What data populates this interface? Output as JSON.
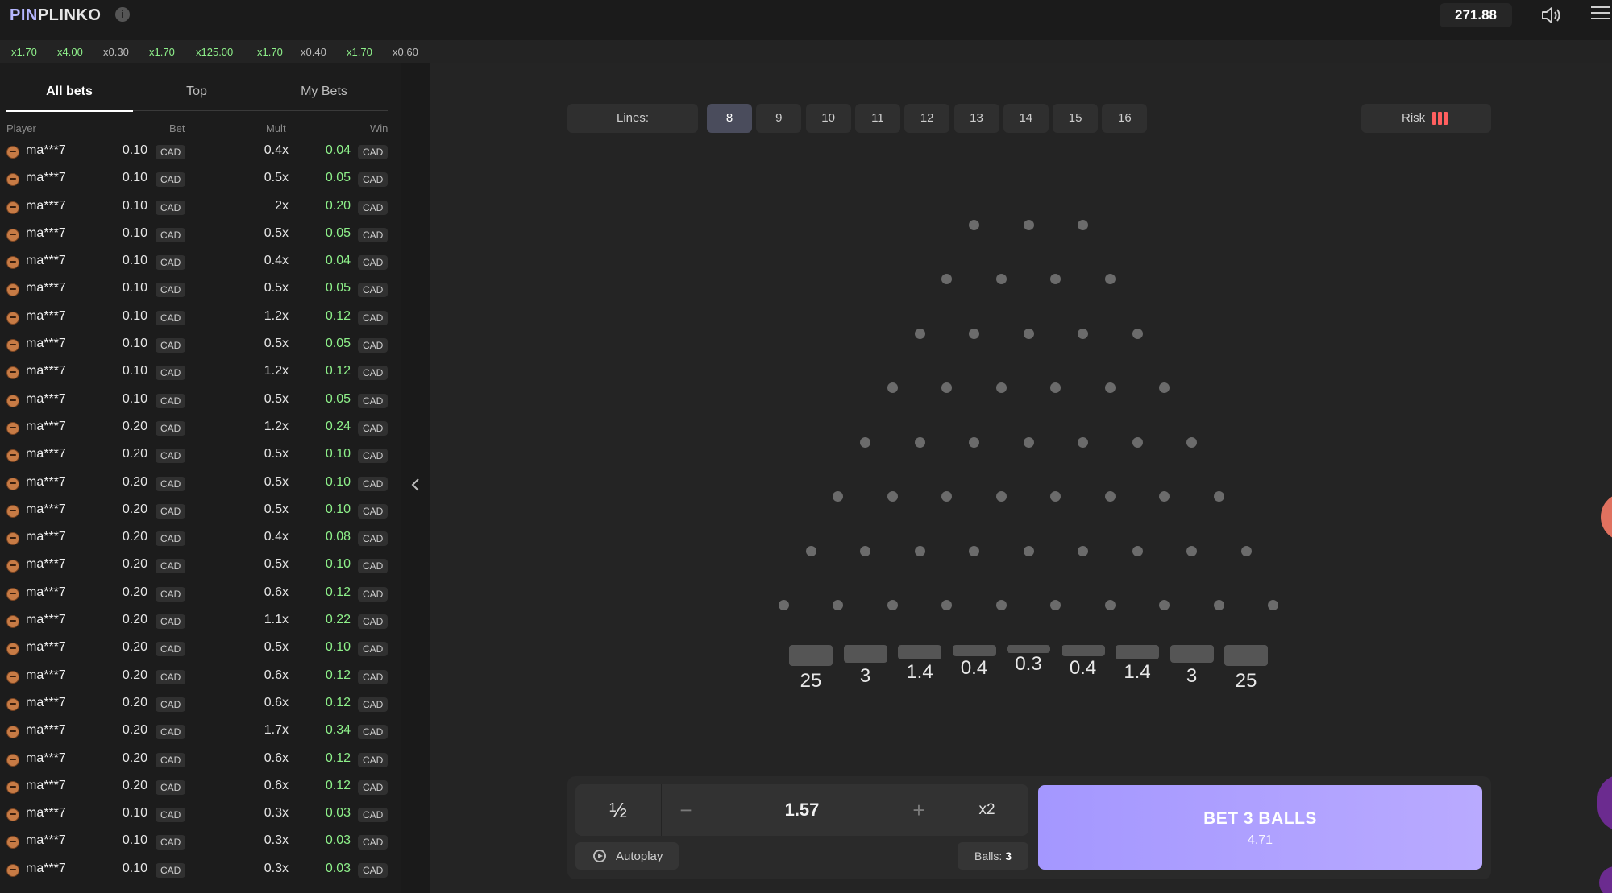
{
  "header": {
    "logo_part1": "PIN",
    "logo_part2": "PLINKO",
    "info_label": "i",
    "balance": "271.88"
  },
  "history": [
    "x1.70",
    "x4.00",
    "x0.30",
    "x1.70",
    "x125.00",
    "x1.70",
    "x0.40",
    "x1.70",
    "x0.60"
  ],
  "sidebar": {
    "tabs": [
      "All bets",
      "Top",
      "My Bets"
    ],
    "columns": {
      "player": "Player",
      "bet": "Bet",
      "mult": "Mult",
      "win": "Win"
    },
    "rows": [
      {
        "player": "ma***7",
        "bet": "0.10",
        "currency": "CAD",
        "mult": "0.4x",
        "win": "0.04"
      },
      {
        "player": "ma***7",
        "bet": "0.10",
        "currency": "CAD",
        "mult": "0.5x",
        "win": "0.05"
      },
      {
        "player": "ma***7",
        "bet": "0.10",
        "currency": "CAD",
        "mult": "2x",
        "win": "0.20"
      },
      {
        "player": "ma***7",
        "bet": "0.10",
        "currency": "CAD",
        "mult": "0.5x",
        "win": "0.05"
      },
      {
        "player": "ma***7",
        "bet": "0.10",
        "currency": "CAD",
        "mult": "0.4x",
        "win": "0.04"
      },
      {
        "player": "ma***7",
        "bet": "0.10",
        "currency": "CAD",
        "mult": "0.5x",
        "win": "0.05"
      },
      {
        "player": "ma***7",
        "bet": "0.10",
        "currency": "CAD",
        "mult": "1.2x",
        "win": "0.12"
      },
      {
        "player": "ma***7",
        "bet": "0.10",
        "currency": "CAD",
        "mult": "0.5x",
        "win": "0.05"
      },
      {
        "player": "ma***7",
        "bet": "0.10",
        "currency": "CAD",
        "mult": "1.2x",
        "win": "0.12"
      },
      {
        "player": "ma***7",
        "bet": "0.10",
        "currency": "CAD",
        "mult": "0.5x",
        "win": "0.05"
      },
      {
        "player": "ma***7",
        "bet": "0.20",
        "currency": "CAD",
        "mult": "1.2x",
        "win": "0.24"
      },
      {
        "player": "ma***7",
        "bet": "0.20",
        "currency": "CAD",
        "mult": "0.5x",
        "win": "0.10"
      },
      {
        "player": "ma***7",
        "bet": "0.20",
        "currency": "CAD",
        "mult": "0.5x",
        "win": "0.10"
      },
      {
        "player": "ma***7",
        "bet": "0.20",
        "currency": "CAD",
        "mult": "0.5x",
        "win": "0.10"
      },
      {
        "player": "ma***7",
        "bet": "0.20",
        "currency": "CAD",
        "mult": "0.4x",
        "win": "0.08"
      },
      {
        "player": "ma***7",
        "bet": "0.20",
        "currency": "CAD",
        "mult": "0.5x",
        "win": "0.10"
      },
      {
        "player": "ma***7",
        "bet": "0.20",
        "currency": "CAD",
        "mult": "0.6x",
        "win": "0.12"
      },
      {
        "player": "ma***7",
        "bet": "0.20",
        "currency": "CAD",
        "mult": "1.1x",
        "win": "0.22"
      },
      {
        "player": "ma***7",
        "bet": "0.20",
        "currency": "CAD",
        "mult": "0.5x",
        "win": "0.10"
      },
      {
        "player": "ma***7",
        "bet": "0.20",
        "currency": "CAD",
        "mult": "0.6x",
        "win": "0.12"
      },
      {
        "player": "ma***7",
        "bet": "0.20",
        "currency": "CAD",
        "mult": "0.6x",
        "win": "0.12"
      },
      {
        "player": "ma***7",
        "bet": "0.20",
        "currency": "CAD",
        "mult": "1.7x",
        "win": "0.34"
      },
      {
        "player": "ma***7",
        "bet": "0.20",
        "currency": "CAD",
        "mult": "0.6x",
        "win": "0.12"
      },
      {
        "player": "ma***7",
        "bet": "0.20",
        "currency": "CAD",
        "mult": "0.6x",
        "win": "0.12"
      },
      {
        "player": "ma***7",
        "bet": "0.10",
        "currency": "CAD",
        "mult": "0.3x",
        "win": "0.03"
      },
      {
        "player": "ma***7",
        "bet": "0.10",
        "currency": "CAD",
        "mult": "0.3x",
        "win": "0.03"
      },
      {
        "player": "ma***7",
        "bet": "0.10",
        "currency": "CAD",
        "mult": "0.3x",
        "win": "0.03"
      }
    ]
  },
  "lines": {
    "label": "Lines:",
    "options": [
      "8",
      "9",
      "10",
      "11",
      "12",
      "13",
      "14",
      "15",
      "16"
    ],
    "selected": "8"
  },
  "risk": {
    "label": "Risk",
    "level": 3
  },
  "multipliers": [
    "25",
    "3",
    "1.4",
    "0.4",
    "0.3",
    "0.4",
    "1.4",
    "3",
    "25"
  ],
  "controls": {
    "half_label": "½",
    "minus_label": "−",
    "amount": "1.57",
    "plus_label": "+",
    "double_label": "x2",
    "autoplay_label": "Autoplay",
    "balls_label": "Balls:",
    "balls_value": "3",
    "bet_button_label": "BET 3 BALLS",
    "bet_button_total": "4.71"
  },
  "colors": {
    "accent": "#a99cff",
    "win": "#8ef08a",
    "risk": "#ff5f5f",
    "history": "#8ef08a"
  }
}
